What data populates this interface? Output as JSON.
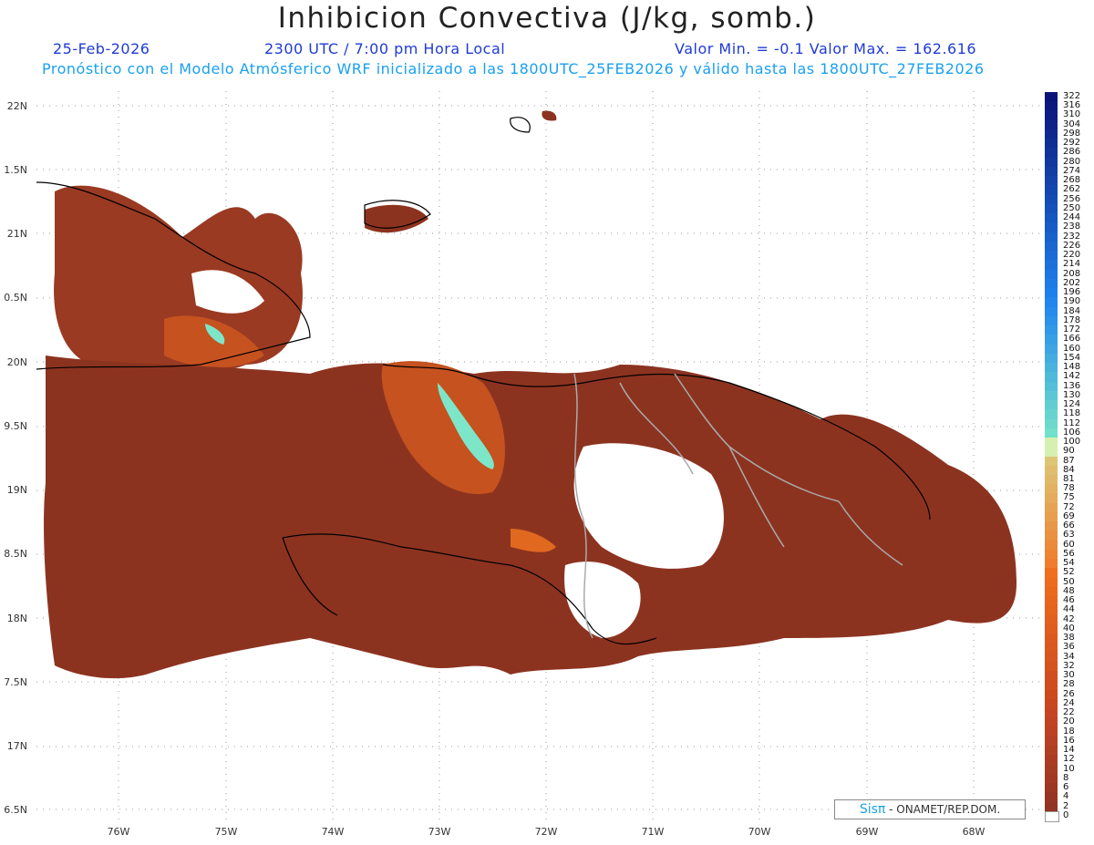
{
  "header": {
    "title": "Inhibicion Convectiva (J/kg, somb.)",
    "date": "25-Feb-2026",
    "time": "2300 UTC / 7:00 pm Hora Local",
    "minmax": "Valor Min. = -0.1  Valor Max. = 162.616",
    "description": "Pronóstico con el Modelo Atmósferico WRF inicializado a las 1800UTC_25FEB2026 y válido hasta las  1800UTC_27FEB2026"
  },
  "axes": {
    "lat_labels": [
      "22N",
      "1.5N",
      "21N",
      "0.5N",
      "20N",
      "9.5N",
      "19N",
      "8.5N",
      "18N",
      "7.5N",
      "17N",
      "6.5N"
    ],
    "lon_labels": [
      "76W",
      "75W",
      "74W",
      "73W",
      "72W",
      "71W",
      "70W",
      "69W",
      "68W"
    ]
  },
  "colorbar": {
    "labels": [
      "322",
      "316",
      "310",
      "304",
      "298",
      "292",
      "286",
      "280",
      "274",
      "268",
      "262",
      "256",
      "250",
      "244",
      "238",
      "232",
      "226",
      "220",
      "214",
      "208",
      "202",
      "196",
      "190",
      "184",
      "178",
      "172",
      "166",
      "160",
      "154",
      "148",
      "142",
      "136",
      "130",
      "124",
      "118",
      "112",
      "106",
      "100",
      "90",
      "87",
      "84",
      "81",
      "78",
      "75",
      "72",
      "69",
      "66",
      "63",
      "60",
      "56",
      "54",
      "52",
      "50",
      "48",
      "46",
      "44",
      "42",
      "40",
      "38",
      "36",
      "34",
      "32",
      "30",
      "28",
      "26",
      "24",
      "22",
      "20",
      "18",
      "16",
      "14",
      "12",
      "10",
      "8",
      "6",
      "4",
      "2",
      "0"
    ]
  },
  "brand": {
    "sis": "Sisπ",
    "org": " - ONAMET/REP.DOM."
  },
  "colors": {
    "land_dark": "#8c3320",
    "land_mid": "#b9461f",
    "land_hot": "#e0681f",
    "highlight": "#7de6c8",
    "coast": "#000000",
    "border_gray": "#aaaaaa"
  }
}
